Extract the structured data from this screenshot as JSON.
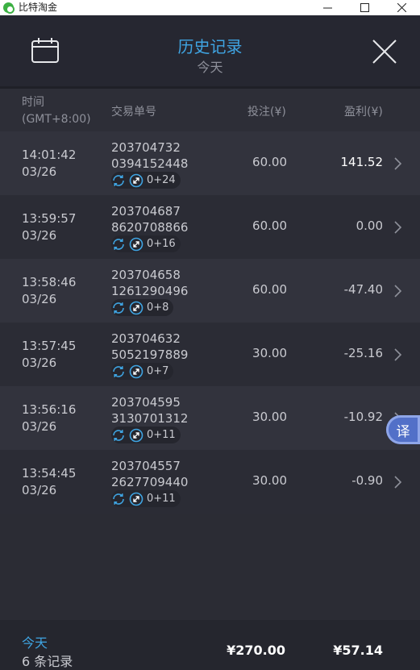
{
  "window": {
    "title": "比特淘金"
  },
  "header": {
    "title": "历史记录",
    "subtitle": "今天"
  },
  "columns": {
    "time_line1": "时间",
    "time_line2": "(GMT+8:00)",
    "order": "交易单号",
    "bet": "投注(¥)",
    "profit": "盈利(¥)"
  },
  "rows": [
    {
      "time": "14:01:42",
      "date": "03/26",
      "order1": "203704732",
      "order2": "0394152448",
      "tag": "0+24",
      "bet": "60.00",
      "profit": "141.52"
    },
    {
      "time": "13:59:57",
      "date": "03/26",
      "order1": "203704687",
      "order2": "8620708866",
      "tag": "0+16",
      "bet": "60.00",
      "profit": "0.00"
    },
    {
      "time": "13:58:46",
      "date": "03/26",
      "order1": "203704658",
      "order2": "1261290496",
      "tag": "0+8",
      "bet": "60.00",
      "profit": "-47.40"
    },
    {
      "time": "13:57:45",
      "date": "03/26",
      "order1": "203704632",
      "order2": "5052197889",
      "tag": "0+7",
      "bet": "30.00",
      "profit": "-25.16"
    },
    {
      "time": "13:56:16",
      "date": "03/26",
      "order1": "203704595",
      "order2": "3130701312",
      "tag": "0+11",
      "bet": "30.00",
      "profit": "-10.92"
    },
    {
      "time": "13:54:45",
      "date": "03/26",
      "order1": "203704557",
      "order2": "2627709440",
      "tag": "0+11",
      "bet": "30.00",
      "profit": "-0.90"
    }
  ],
  "translate": {
    "label": "译"
  },
  "footer": {
    "today": "今天",
    "count": "6 条记录",
    "total_bet": "¥270.00",
    "total_profit": "¥57.14"
  },
  "colors": {
    "accent": "#3fa4e2",
    "background": "#2b2c34"
  },
  "icons": {
    "calendar": "calendar-icon",
    "close": "close-icon",
    "chevron": "chevron-right-icon",
    "refresh": "refresh-icon",
    "expand": "expand-icon"
  }
}
